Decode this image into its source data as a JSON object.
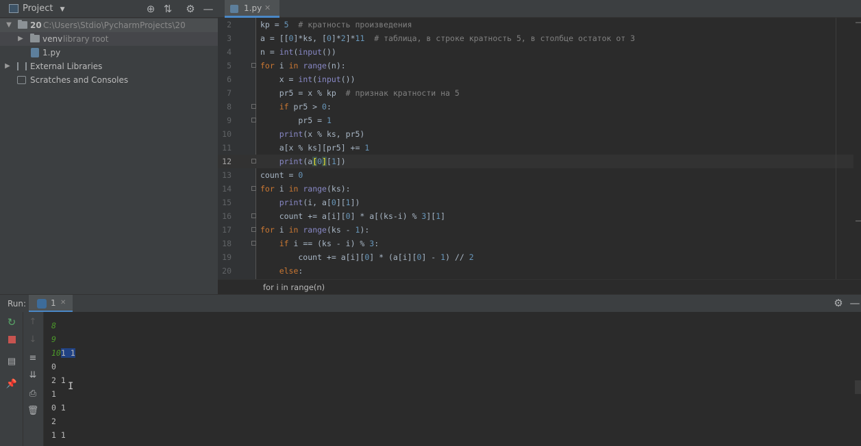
{
  "project_panel": {
    "title": "Project",
    "tree": [
      {
        "name": "20",
        "hint": "C:\\Users\\Stdio\\PycharmProjects\\20"
      },
      {
        "name": "venv",
        "hint": "library root"
      },
      {
        "name": "1.py",
        "hint": ""
      },
      {
        "name": "External Libraries",
        "hint": ""
      },
      {
        "name": "Scratches and Consoles",
        "hint": ""
      }
    ]
  },
  "editor": {
    "tab_label": "1.py",
    "current_line": 12,
    "line_numbers": [
      "2",
      "3",
      "4",
      "5",
      "6",
      "7",
      "8",
      "9",
      "10",
      "11",
      "12",
      "13",
      "14",
      "15",
      "16",
      "17",
      "18",
      "19",
      "20"
    ],
    "breadcrumb": "for i in range(n)"
  },
  "run_panel": {
    "label": "Run:",
    "tab_label": "1",
    "console_lines": [
      {
        "a": "8",
        "b": ""
      },
      {
        "a": "9",
        "b": ""
      },
      {
        "a": "10",
        "b": "1 1"
      },
      {
        "a": "",
        "b": "0"
      },
      {
        "a": "",
        "b": "2 1"
      },
      {
        "a": "",
        "b": "1"
      },
      {
        "a": "",
        "b": "0 1"
      },
      {
        "a": "",
        "b": "2"
      },
      {
        "a": "",
        "b": "1 1"
      }
    ]
  },
  "colors": {
    "keyword": "#cc7832",
    "number": "#6897bb",
    "builtin": "#8888c6",
    "comment": "#808080",
    "accent": "#4a88c7"
  }
}
